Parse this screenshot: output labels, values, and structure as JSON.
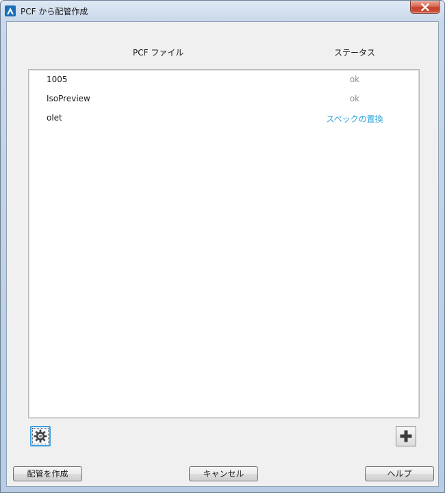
{
  "window": {
    "title": "PCF から配管作成"
  },
  "table": {
    "headers": {
      "pcf_file": "PCF ファイル",
      "status": "ステータス"
    },
    "rows": [
      {
        "name": "1005",
        "status": "ok",
        "status_kind": "ok"
      },
      {
        "name": "IsoPreview",
        "status": "ok",
        "status_kind": "ok"
      },
      {
        "name": "olet",
        "status": "スペックの置換",
        "status_kind": "link"
      }
    ]
  },
  "icons": {
    "app": "autodesk-a-icon",
    "settings": "gear-icon",
    "add": "plus-icon",
    "close": "close-icon"
  },
  "buttons": {
    "create": "配管を作成",
    "cancel": "キャンセル",
    "help": "ヘルプ"
  },
  "colors": {
    "status_ok": "#8c8c8c",
    "status_link": "#2aa3d8",
    "close_red": "#c3412a",
    "focus_blue": "#3aa0e0"
  }
}
